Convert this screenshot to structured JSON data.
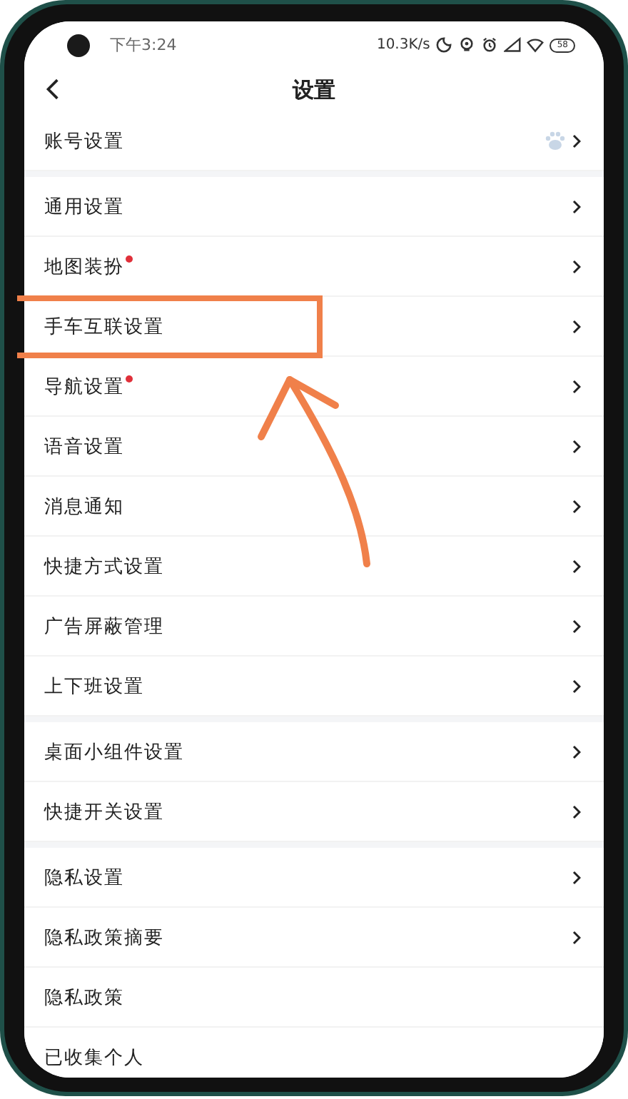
{
  "status_bar": {
    "time": "下午3:24",
    "net_speed": "10.3K/s",
    "battery": "58"
  },
  "header": {
    "title": "设置"
  },
  "sections": [
    {
      "items": [
        {
          "label": "账号设置",
          "kind": "account",
          "dot": false,
          "chevron": true
        }
      ]
    },
    {
      "items": [
        {
          "label": "通用设置",
          "kind": "plain",
          "dot": false,
          "chevron": true
        },
        {
          "label": "地图装扮",
          "kind": "plain",
          "dot": true,
          "chevron": true
        },
        {
          "label": "手车互联设置",
          "kind": "plain",
          "dot": false,
          "chevron": true
        },
        {
          "label": "导航设置",
          "kind": "plain",
          "dot": true,
          "chevron": true
        },
        {
          "label": "语音设置",
          "kind": "plain",
          "dot": false,
          "chevron": true
        },
        {
          "label": "消息通知",
          "kind": "plain",
          "dot": false,
          "chevron": true
        },
        {
          "label": "快捷方式设置",
          "kind": "plain",
          "dot": false,
          "chevron": true
        },
        {
          "label": "广告屏蔽管理",
          "kind": "plain",
          "dot": false,
          "chevron": true
        },
        {
          "label": "上下班设置",
          "kind": "plain",
          "dot": false,
          "chevron": true
        }
      ]
    },
    {
      "items": [
        {
          "label": "桌面小组件设置",
          "kind": "plain",
          "dot": false,
          "chevron": true
        },
        {
          "label": "快捷开关设置",
          "kind": "plain",
          "dot": false,
          "chevron": true
        }
      ]
    },
    {
      "items": [
        {
          "label": "隐私设置",
          "kind": "plain",
          "dot": false,
          "chevron": true
        },
        {
          "label": "隐私政策摘要",
          "kind": "plain",
          "dot": false,
          "chevron": true
        },
        {
          "label": "隐私政策",
          "kind": "plain",
          "dot": false,
          "chevron": false
        },
        {
          "label": "已收集个人",
          "kind": "plain",
          "dot": false,
          "chevron": false
        }
      ]
    }
  ]
}
